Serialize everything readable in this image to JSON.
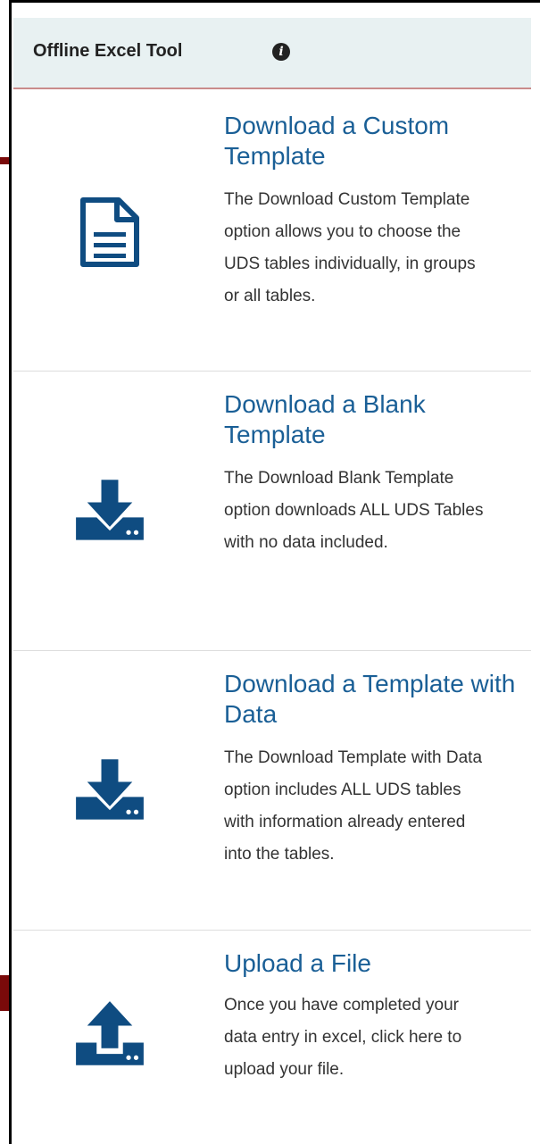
{
  "header": {
    "title": "Offline Excel Tool",
    "info_icon": "info-circle-icon"
  },
  "items": [
    {
      "title": "Download a Custom Template",
      "description": "The Download Custom Template option allows you to choose the UDS tables individually, in groups or all tables.",
      "icon": "document-icon"
    },
    {
      "title": "Download a Blank Template",
      "description": "The Download Blank Template option downloads ALL UDS Tables with no data included.",
      "icon": "download-icon"
    },
    {
      "title": "Download a Template with Data",
      "description": "The Download Template with Data option includes ALL UDS tables with information already entered into the tables.",
      "icon": "download-icon"
    },
    {
      "title": "Upload a File",
      "description": "Once you have completed your data entry in excel, click here to upload your file.",
      "icon": "upload-icon"
    }
  ],
  "colors": {
    "link": "#1a5f96",
    "icon": "#0f4c81",
    "header_bg": "#e8f1f2",
    "header_border": "#c98b8b",
    "callout": "#7a0a0a"
  }
}
